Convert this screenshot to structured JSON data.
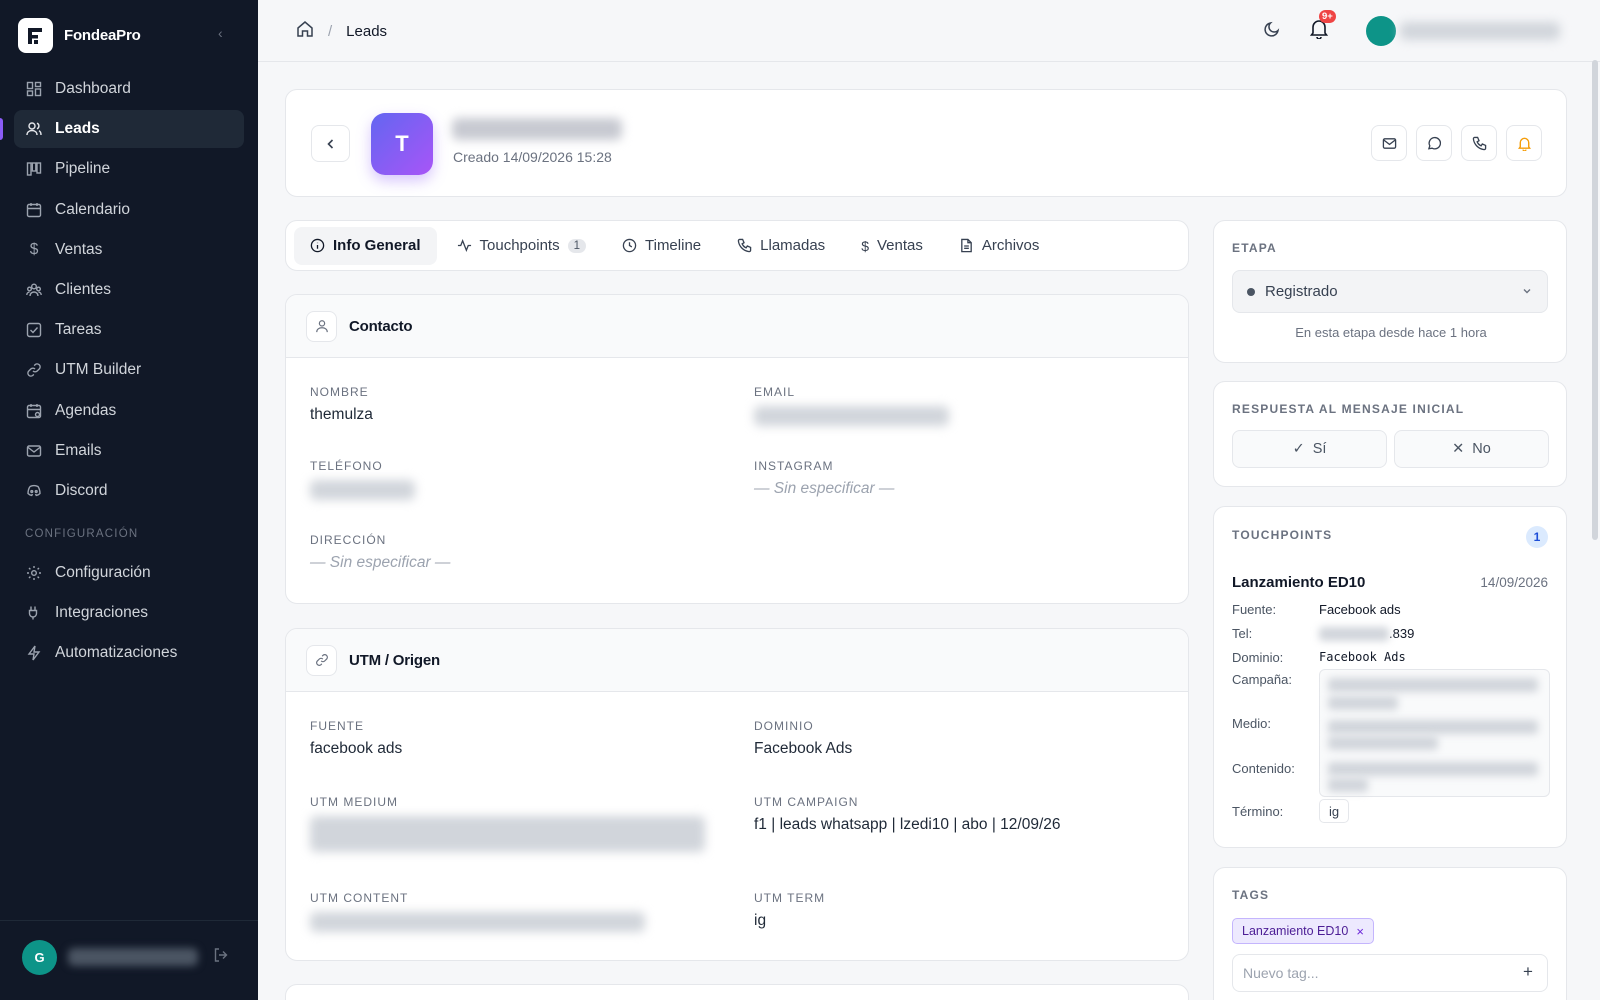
{
  "app": {
    "name": "FondeaPro"
  },
  "sidebar": {
    "items": [
      {
        "label": "Dashboard",
        "icon": "dashboard-icon"
      },
      {
        "label": "Leads",
        "icon": "users-icon",
        "active": true
      },
      {
        "label": "Pipeline",
        "icon": "pipeline-icon"
      },
      {
        "label": "Calendario",
        "icon": "calendar-icon"
      },
      {
        "label": "Ventas",
        "icon": "dollar-icon"
      },
      {
        "label": "Clientes",
        "icon": "clients-icon"
      },
      {
        "label": "Tareas",
        "icon": "tasks-icon"
      },
      {
        "label": "UTM Builder",
        "icon": "link-icon"
      },
      {
        "label": "Agendas",
        "icon": "agenda-icon"
      },
      {
        "label": "Emails",
        "icon": "mail-icon"
      },
      {
        "label": "Discord",
        "icon": "discord-icon"
      }
    ],
    "section_label": "CONFIGURACIÓN",
    "config_items": [
      {
        "label": "Configuración",
        "icon": "gear-icon"
      },
      {
        "label": "Integraciones",
        "icon": "integrations-icon"
      },
      {
        "label": "Automatizaciones",
        "icon": "bolt-icon"
      }
    ],
    "user_initial": "G"
  },
  "topbar": {
    "breadcrumb": "Leads",
    "notification_badge": "9+"
  },
  "lead": {
    "initial": "T",
    "created": "Creado 14/09/2026 15:28"
  },
  "tabs": [
    {
      "label": "Info General",
      "icon": "info-icon",
      "active": true
    },
    {
      "label": "Touchpoints",
      "icon": "activity-icon",
      "count": "1"
    },
    {
      "label": "Timeline",
      "icon": "clock-icon"
    },
    {
      "label": "Llamadas",
      "icon": "phone-icon"
    },
    {
      "label": "Ventas",
      "icon": "dollar-icon"
    },
    {
      "label": "Archivos",
      "icon": "file-icon"
    }
  ],
  "contacto": {
    "title": "Contacto",
    "nombre_label": "NOMBRE",
    "nombre": "themulza",
    "email_label": "EMAIL",
    "telefono_label": "TELÉFONO",
    "instagram_label": "INSTAGRAM",
    "instagram": "— Sin especificar —",
    "direccion_label": "DIRECCIÓN",
    "direccion": "— Sin especificar —"
  },
  "utm": {
    "title": "UTM / Origen",
    "fuente_label": "FUENTE",
    "fuente": "facebook ads",
    "dominio_label": "DOMINIO",
    "dominio": "Facebook Ads",
    "medium_label": "UTM MEDIUM",
    "campaign_label": "UTM CAMPAIGN",
    "campaign": "f1 | leads whatsapp | lzedi10 | abo | 12/09/26",
    "content_label": "UTM CONTENT",
    "term_label": "UTM TERM",
    "term": "ig"
  },
  "etapa": {
    "label": "ETAPA",
    "value": "Registrado",
    "note": "En esta etapa desde hace 1 hora"
  },
  "respuesta": {
    "label": "RESPUESTA AL MENSAJE INICIAL",
    "yes": "Sí",
    "no": "No"
  },
  "touchpoints": {
    "label": "TOUCHPOINTS",
    "count": "1",
    "title": "Lanzamiento ED10",
    "date": "14/09/2026",
    "fuente_label": "Fuente:",
    "fuente": "Facebook ads",
    "tel_label": "Tel:",
    "tel_suffix": ".839",
    "dominio_label": "Dominio:",
    "dominio": "Facebook Ads",
    "campana_label": "Campaña:",
    "medio_label": "Medio:",
    "contenido_label": "Contenido:",
    "termino_label": "Término:",
    "termino": "ig"
  },
  "tags": {
    "label": "TAGS",
    "chip": "Lanzamiento ED10",
    "remove": "×",
    "placeholder": "Nuevo tag...",
    "add": "+"
  }
}
